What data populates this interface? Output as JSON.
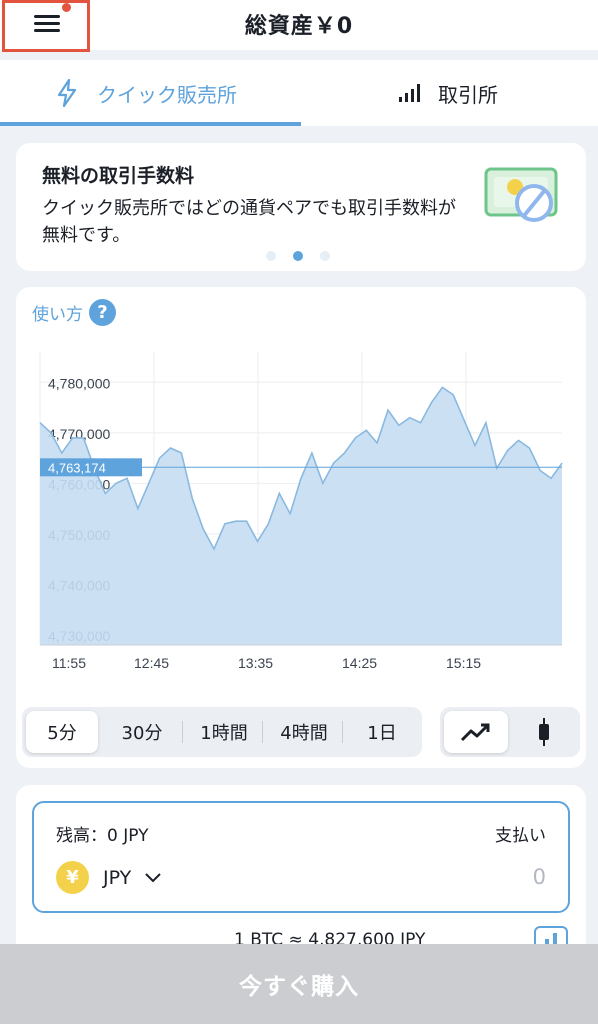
{
  "header": {
    "title": "総資産￥0"
  },
  "tabs": [
    {
      "label": "クイック販売所",
      "active": true
    },
    {
      "label": "取引所",
      "active": false
    }
  ],
  "promo": {
    "title": "無料の取引手数料",
    "description": "クイック販売所ではどの通貨ペアでも取引手数料が無料です。",
    "pages": 3,
    "active_page": 1
  },
  "howto": {
    "label": "使い方",
    "icon": "?"
  },
  "chart_data": {
    "type": "area",
    "x_ticks": [
      "11:55",
      "12:45",
      "13:35",
      "14:25",
      "15:15"
    ],
    "y_ticks": [
      "4,780,000",
      "4,770,000",
      "4,760,000",
      "4,750,000",
      "4,740,000",
      "4,730,000"
    ],
    "ylim": [
      4728000,
      4786000
    ],
    "current_price": 4763174,
    "current_price_label": "4,763,174",
    "values": [
      4772000,
      4770000,
      4766000,
      4769000,
      4769000,
      4763000,
      4758000,
      4760000,
      4761000,
      4755000,
      4760000,
      4765000,
      4767000,
      4766000,
      4757000,
      4751000,
      4747000,
      4752000,
      4752500,
      4752500,
      4748500,
      4752000,
      4758000,
      4754000,
      4761000,
      4766000,
      4760000,
      4764000,
      4766000,
      4769000,
      4770500,
      4768000,
      4774500,
      4771500,
      4773000,
      4772000,
      4776000,
      4779000,
      4777500,
      4772500,
      4767500,
      4772000,
      4763000,
      4766500,
      4768500,
      4767000,
      4762500,
      4761000,
      4764000
    ],
    "colors": {
      "line": "#8ab9e0",
      "fill": "#c6ddf3",
      "marker": "#5fa3dc"
    }
  },
  "intervals": [
    "5分",
    "30分",
    "1時間",
    "4時間",
    "1日"
  ],
  "active_interval": 0,
  "chart_types": [
    "line-chart-icon",
    "candlestick-icon"
  ],
  "active_chart_type": 0,
  "order": {
    "balance": "残高：0 JPY",
    "pay_label": "支払い",
    "currency": "JPY",
    "currency_symbol": "¥",
    "amount_placeholder": "0",
    "rate": "1 BTC ≈ 4,827,600 JPY"
  },
  "buy_button": "今すぐ購入"
}
